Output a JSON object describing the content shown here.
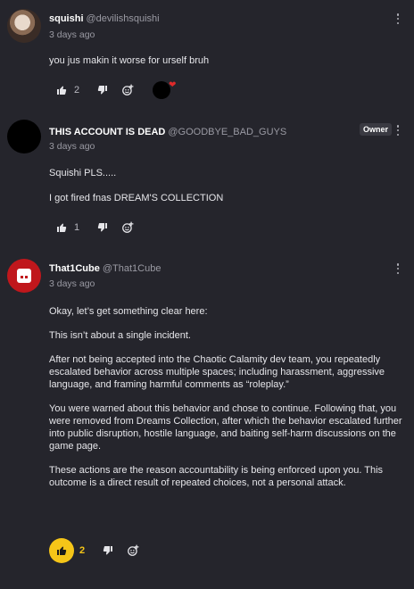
{
  "comments": [
    {
      "name": "squishi",
      "handle": "@devilishsquishi",
      "time": "3 days ago",
      "paragraphs": [
        "you jus makin it worse for urself bruh"
      ],
      "likes": "2",
      "creator_hearted": true
    },
    {
      "name": "THIS ACCOUNT IS DEAD",
      "handle": "@GOODBYE_BAD_GUYS",
      "badge": "Owner",
      "time": "3 days ago",
      "paragraphs": [
        "Squishi PLS.....",
        "I got fired fnas DREAM'S COLLECTION"
      ],
      "likes": "1"
    },
    {
      "name": "That1Cube",
      "handle": "@That1Cube",
      "time": "3 days ago",
      "paragraphs": [
        "Okay, let’s get something clear here:",
        "This isn’t about a single incident.",
        "After not being accepted into the Chaotic Calamity dev team, you repeatedly escalated behavior across multiple spaces; including harassment, aggressive language, and framing harmful comments as “roleplay.”",
        "You were warned about this behavior and chose to continue. Following that, you were removed from Dreams Collection, after which the behavior escalated further into public disruption, hostile language, and baiting self-harm discussions on the game page.",
        "These actions are the reason accountability is being enforced upon you. This outcome is a direct result of repeated choices, not a personal attack."
      ],
      "likes": "2",
      "liked": true
    }
  ],
  "icons": {
    "like": "thumbs-up-icon",
    "dislike": "thumbs-down-icon",
    "reply": "emoji-add-icon",
    "menu": "more-vertical-icon"
  },
  "colors": {
    "background": "#25252c",
    "accent_like": "#f5c518",
    "heart": "#e02a2a"
  }
}
